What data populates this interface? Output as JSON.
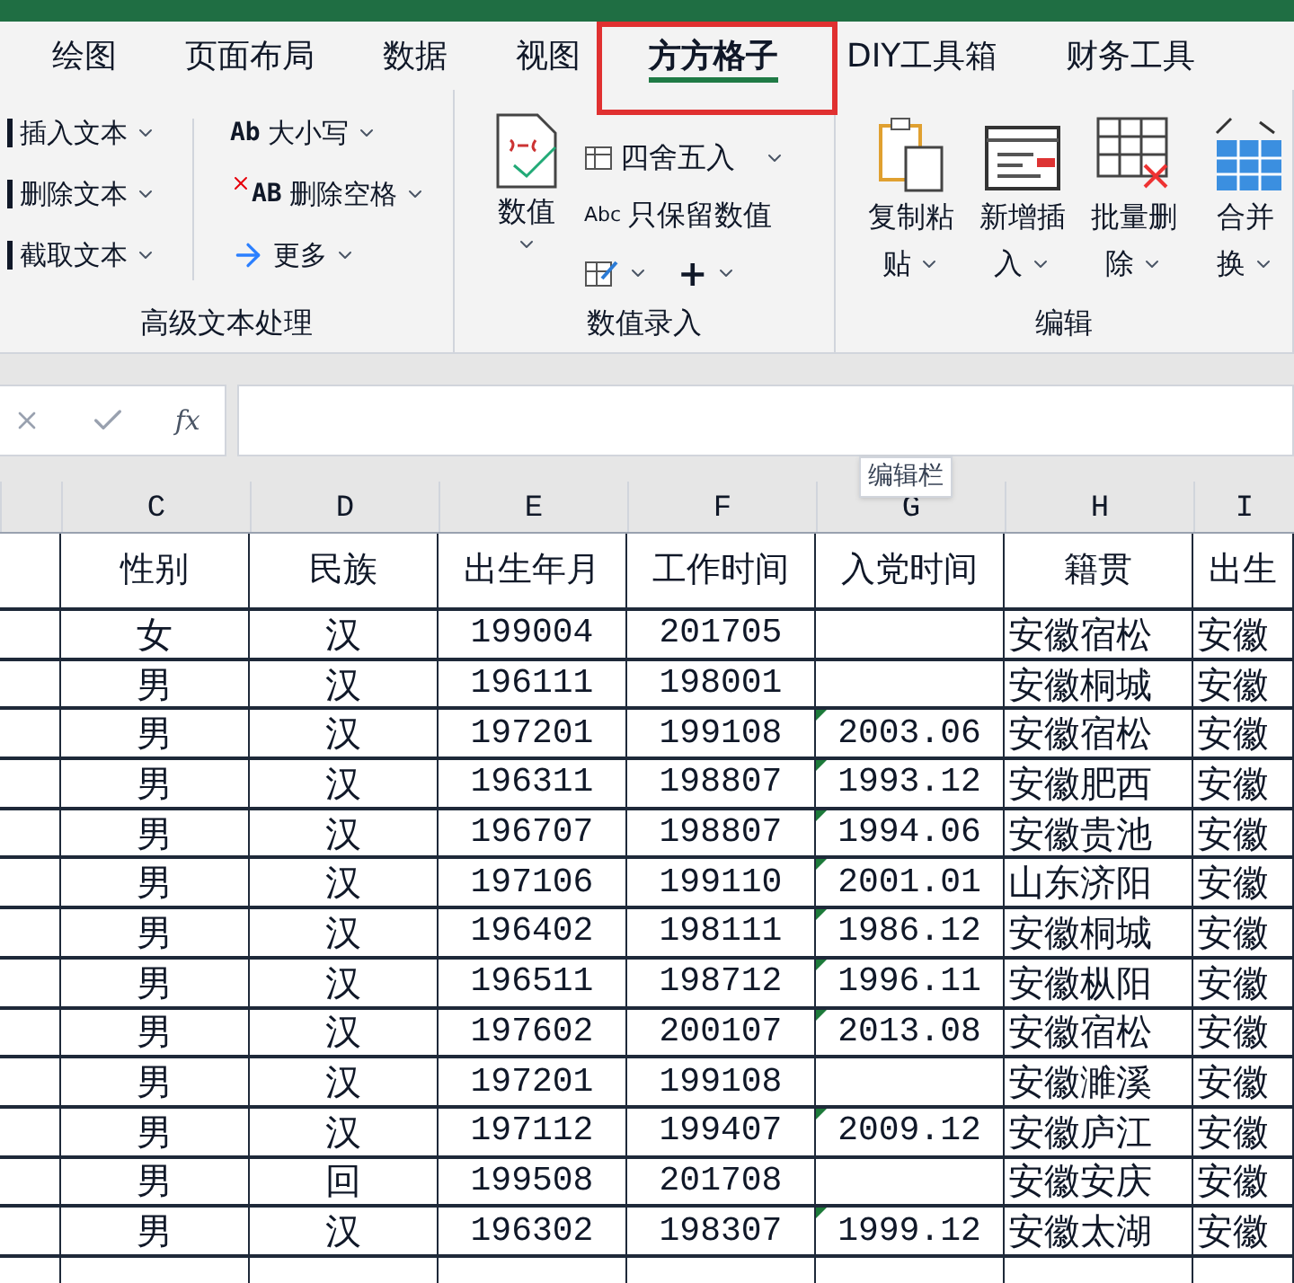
{
  "tabs": [
    {
      "label": "绘图",
      "selected": false
    },
    {
      "label": "页面布局",
      "selected": false
    },
    {
      "label": "数据",
      "selected": false
    },
    {
      "label": "视图",
      "selected": false
    },
    {
      "label": "方方格子",
      "selected": true
    },
    {
      "label": "DIY工具箱",
      "selected": false
    },
    {
      "label": "财务工具",
      "selected": false
    }
  ],
  "ribbon": {
    "groups": [
      {
        "kind": "text",
        "title": "高级文本处理",
        "items": [
          {
            "label": "插入文本"
          },
          {
            "label": "删除文本"
          },
          {
            "label": "截取文本"
          },
          {
            "icon_text": "Ab",
            "label": "大小写"
          },
          {
            "icon_text": "AB",
            "label": "删除空格"
          },
          {
            "label": "更多"
          }
        ]
      },
      {
        "kind": "number",
        "title": "数值录入",
        "big": {
          "label": "数值"
        },
        "items": [
          {
            "label": "四舍五入"
          },
          {
            "icon_text": "Abc",
            "label": "只保留数值"
          },
          {
            "kind": "icon"
          },
          {
            "kind": "symbol",
            "icon_text": "+"
          }
        ]
      },
      {
        "kind": "edit",
        "title": "编辑",
        "items": [
          {
            "lines": [
              "复制粘",
              "贴"
            ]
          },
          {
            "lines": [
              "新增插",
              "入"
            ]
          },
          {
            "lines": [
              "批量删",
              "除"
            ]
          },
          {
            "lines": [
              "合并",
              "换"
            ]
          }
        ]
      }
    ]
  },
  "formula_bar": {
    "fx": "fx",
    "tooltip": "编辑栏"
  },
  "sheet": {
    "columns": [
      "C",
      "D",
      "E",
      "F",
      "G",
      "H",
      "I"
    ],
    "header": [
      "性别",
      "民族",
      "出生年月",
      "工作时间",
      "入党时间",
      "籍贯",
      "出生"
    ],
    "rows": [
      [
        "女",
        "汉",
        "199004",
        "201705",
        "",
        "安徽宿松",
        "安徽"
      ],
      [
        "男",
        "汉",
        "196111",
        "198001",
        "",
        "安徽桐城",
        "安徽"
      ],
      [
        "男",
        "汉",
        "197201",
        "199108",
        "2003.06",
        "安徽宿松",
        "安徽"
      ],
      [
        "男",
        "汉",
        "196311",
        "198807",
        "1993.12",
        "安徽肥西",
        "安徽"
      ],
      [
        "男",
        "汉",
        "196707",
        "198807",
        "1994.06",
        "安徽贵池",
        "安徽"
      ],
      [
        "男",
        "汉",
        "197106",
        "199110",
        "2001.01",
        "山东济阳",
        "安徽"
      ],
      [
        "男",
        "汉",
        "196402",
        "198111",
        "1986.12",
        "安徽桐城",
        "安徽"
      ],
      [
        "男",
        "汉",
        "196511",
        "198712",
        "1996.11",
        "安徽枞阳",
        "安徽"
      ],
      [
        "男",
        "汉",
        "197602",
        "200107",
        "2013.08",
        "安徽宿松",
        "安徽"
      ],
      [
        "男",
        "汉",
        "197201",
        "199108",
        "",
        "安徽濉溪",
        "安徽"
      ],
      [
        "男",
        "汉",
        "197112",
        "199407",
        "2009.12",
        "安徽庐江",
        "安徽"
      ],
      [
        "男",
        "回",
        "199508",
        "201708",
        "",
        "安徽安庆",
        "安徽"
      ],
      [
        "男",
        "汉",
        "196302",
        "198307",
        "1999.12",
        "安徽太湖",
        "安徽"
      ]
    ]
  }
}
